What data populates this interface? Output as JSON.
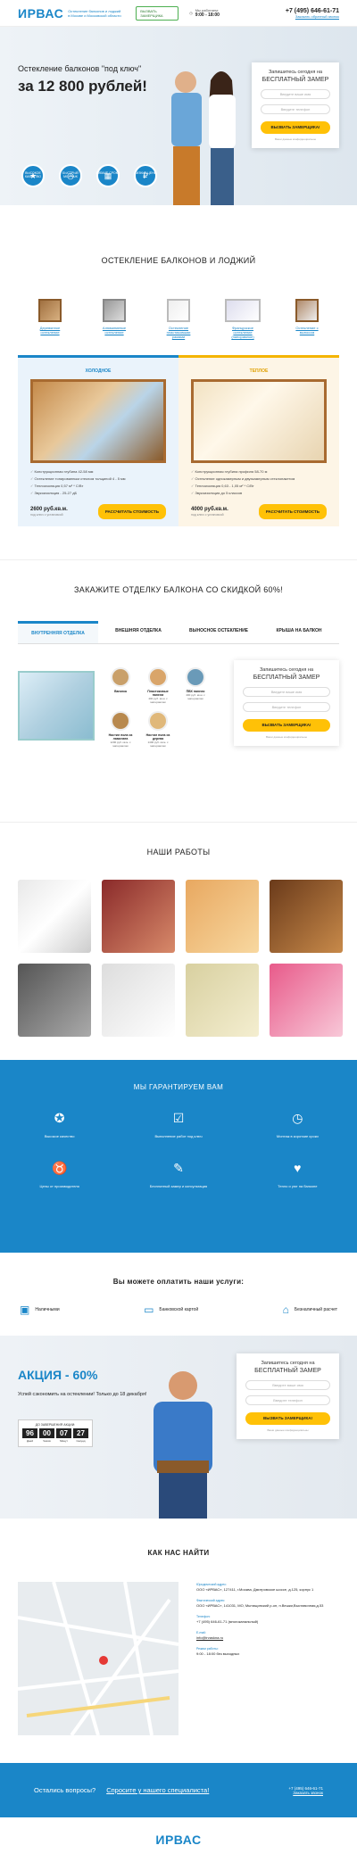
{
  "header": {
    "logo": "ИРВАС",
    "tagline": "Остекление балконов и лоджий в Москве и Московской области",
    "call_btn": "ВЫЗВАТЬ ЗАМЕРЩИКА",
    "hours_label": "Мы работаем:",
    "hours": "9:00 - 18:00",
    "phone": "+7 (495) 646-61-71",
    "callback": "Заказать обратный звонок"
  },
  "hero": {
    "subtitle": "Остекление балконов \"под ключ\"",
    "title": "за 12 800 рублей!",
    "badges": [
      "ВЫСОКОЕ КАЧЕСТВО",
      "БЫСТРЫЙ МОНТАЖ",
      "ГИБКИЕ СРОКИ",
      "НИЗКИЕ ЦЕНЫ"
    ]
  },
  "form": {
    "top": "Запишитесь сегодня на",
    "big": "БЕСПЛАТНЫЙ ЗАМЕР",
    "name_ph": "Введите ваше имя",
    "phone_ph": "Введите телефон",
    "btn": "ВЫЗВАТЬ ЗАМЕРЩИКА!",
    "note": "Ваши данные конфиденциальны"
  },
  "glazing": {
    "title": "ОСТЕКЛЕНИЕ БАЛКОНОВ И ЛОДЖИЙ",
    "types": [
      "Деревянное остекление",
      "Алюминиевое остекление",
      "Остекление пластиковыми рамами",
      "Французское остекление (панорамное)",
      "Остекление с выносом"
    ]
  },
  "cold": {
    "label": "ХОЛОДНОЕ",
    "features": [
      "Конструкционная глубина 42-58 мм",
      "Остекление тонированным стеклом толщиной 4 - 5 мм",
      "Теплоизоляция 0,57 м² * С/Вт",
      "Звукоизоляция - 25-27 дБ"
    ],
    "price": "2600 руб.кв.м.",
    "price_note": "под ключ с установкой",
    "btn": "РАССЧИТАТЬ СТОИМОСТЬ"
  },
  "warm": {
    "label": "ТЕПЛОЕ",
    "features": [
      "Конструкционная глубина профиля 58-70 м",
      "Остекление однокамерным и двухкамерным стеклопакетом",
      "Теплоизоляция 0,63 - 1,05 м² * С/Вт",
      "Звукоизоляция до 5 классов"
    ],
    "price": "4000 руб.кв.м.",
    "price_note": "под ключ с установкой",
    "btn": "РАССЧИТАТЬ СТОИМОСТЬ"
  },
  "finishing": {
    "title": "ЗАКАЖИТЕ ОТДЕЛКУ БАЛКОНА СО СКИДКОЙ 60%!",
    "tabs": [
      "ВНУТРЕННЯЯ ОТДЕЛКА",
      "ВНЕШНЯЯ ОТДЕЛКА",
      "ВЫНОСНОЕ ОСТЕКЛЕНИЕ",
      "КРЫША НА БАЛКОН"
    ],
    "materials": [
      {
        "name": "Вагонка",
        "price": ""
      },
      {
        "name": "Пластиковые панели",
        "price": "400 руб. кв.м. с материалом"
      },
      {
        "name": "ПВХ панели",
        "price": "400 руб. кв.м. с материалом"
      },
      {
        "name": "Настил пола из ламината",
        "price": "1200 руб. кв.м. с материалом"
      },
      {
        "name": "Настил пола из дерева",
        "price": "1400 руб. кв.м. с материалом"
      }
    ]
  },
  "works": {
    "title": "НАШИ РАБОТЫ"
  },
  "guarantee": {
    "title": "МЫ ГАРАНТИРУЕМ ВАМ",
    "items": [
      "Высокое качество",
      "Выполнение работ под ключ",
      "Монтаж в короткие сроки",
      "Цены от производителя",
      "Бесплатный замер и консультация",
      "Тепло и уют на балконе"
    ]
  },
  "payment": {
    "title": "Вы можете оплатить наши услуги:",
    "methods": [
      "Наличными",
      "Банковской картой",
      "Безналичный расчет"
    ]
  },
  "promo": {
    "title": "АКЦИЯ - 60%",
    "text": "Успей сэкономить на остеклении! Только до 18 декабря!",
    "timer_label": "ДО ЗАВЕРШЕНИЯ АКЦИИ:",
    "timer": [
      {
        "v": "96",
        "u": "Дней"
      },
      {
        "v": "00",
        "u": "Часов"
      },
      {
        "v": "07",
        "u": "Минут"
      },
      {
        "v": "27",
        "u": "Секунд"
      }
    ]
  },
  "contacts": {
    "title": "КАК НАС НАЙТИ",
    "legal_label": "Юридический адрес:",
    "legal": "ООО «ИРВАС», 127411, г.Москва, Дмитровское шоссе, д.125, корпус 1",
    "fact_label": "Фактический адрес:",
    "fact": "ООО «ИРВАС», 141031, МО, Мытищинский р-он, п.Вешки,Выставочная,д.53",
    "phone_label": "Телефон:",
    "phone": "+7 (495) 646-61-71 (многоканальный)",
    "email_label": "E-mail:",
    "email": "info@irvaskna.ru",
    "hours_label": "Режим работы:",
    "hours": "9:00 - 18:00 без выходных"
  },
  "bottom": {
    "question": "Остались вопросы?",
    "link": "Спросите у нашего специалиста!",
    "phone": "+7 (495) 646-61-71",
    "callback": "Заказать звонок"
  },
  "footer": {
    "logo": "ИРВАС"
  }
}
